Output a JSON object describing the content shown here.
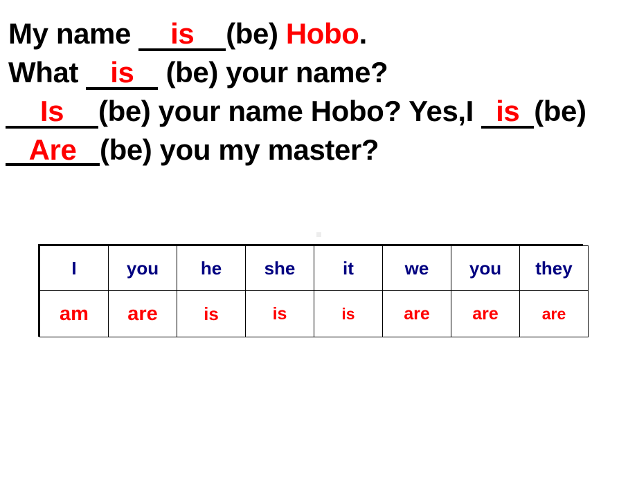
{
  "slide": {
    "background_color": "#ffffff",
    "text_color": "#000000",
    "answer_color": "#ff0000",
    "pronoun_color": "#000080"
  },
  "exercise": {
    "lines": [
      {
        "id": "line-1",
        "before": "My name ",
        "answer": "is",
        "after": "(be) ",
        "highlight": "Hobo",
        "tail": "."
      },
      {
        "id": "line-2",
        "before": "What ",
        "answer": "is",
        "after": " (be) your name?"
      },
      {
        "id": "line-3",
        "before": "",
        "answer": "Is",
        "after": "(be) your name Hobo? Yes,I ",
        "answer2": "is",
        "after2": "(be)"
      },
      {
        "id": "line-4",
        "before": "",
        "answer": "Are",
        "after": "(be) you my master?"
      }
    ]
  },
  "table": {
    "pronouns": [
      "I",
      "you",
      "he",
      "she",
      "it",
      "we",
      "you",
      "they"
    ],
    "verbs": [
      "am",
      "are",
      "is",
      "is",
      "is",
      "are",
      "are",
      "are"
    ]
  }
}
